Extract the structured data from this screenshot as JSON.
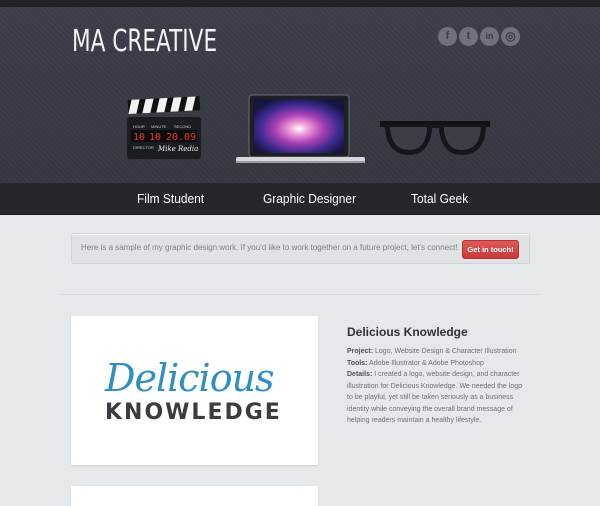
{
  "header": {
    "logo": "MA CREATIVE",
    "social": [
      {
        "name": "facebook-icon",
        "glyph": "f"
      },
      {
        "name": "twitter-icon",
        "glyph": "t"
      },
      {
        "name": "linkedin-icon",
        "glyph": "in"
      },
      {
        "name": "dribbble-icon",
        "glyph": "◎"
      }
    ],
    "clapper": {
      "labels": [
        "HOUR",
        "MINUTE",
        "SECOND"
      ],
      "digits": [
        "10",
        "10",
        "20.09"
      ],
      "director_label": "DIRECTOR",
      "director_value": "Mike Redia"
    }
  },
  "nav": {
    "items": [
      "Film Student",
      "Graphic Designer",
      "Total Geek"
    ]
  },
  "notice": {
    "text": "Here is a sample of my graphic design work. If you'd like to work together on a future project, let's connect!",
    "button": "Get in touch!"
  },
  "project": {
    "logo_line1": "Delicious",
    "logo_line2": "KNOWLEDGE",
    "title": "Delicious Knowledge",
    "project_label": "Project:",
    "project_value": "Logo, Website Design & Character Illustration",
    "tools_label": "Tools:",
    "tools_value": "Adobe Illustrator & Adobe Photoshop",
    "details_label": "Details:",
    "details_value": "I created a logo, website design, and character illustration for Delicious Knowledge. We needed the logo to be playful, yet still be taken seriously as a business identity while conveying the overall brand message of helping readers maintain a healthy lifestyle."
  },
  "colors": {
    "header_bg": "#373944",
    "nav_bg": "#26272d",
    "page_bg": "#e6e9ec",
    "button_red": "#d74a4a",
    "brand_blue": "#2e8fc6"
  }
}
